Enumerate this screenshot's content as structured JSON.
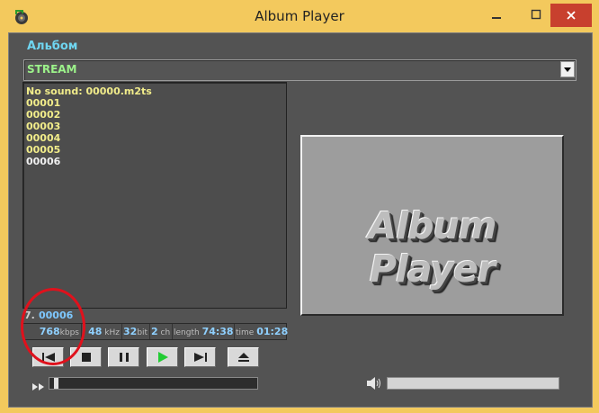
{
  "window": {
    "title": "Album Player",
    "colors": {
      "frame": "#f3c95d",
      "close_button": "#c8402e",
      "client_bg": "#535353"
    }
  },
  "album": {
    "label": "Альбом",
    "selected": "STREAM"
  },
  "playlist": {
    "items": [
      {
        "label": "No sound: 00000.m2ts",
        "color": "#f1ec8a"
      },
      {
        "label": "00001",
        "color": "#f1ec8a"
      },
      {
        "label": "00002",
        "color": "#f1ec8a"
      },
      {
        "label": "00003",
        "color": "#f1ec8a"
      },
      {
        "label": "00004",
        "color": "#f1ec8a"
      },
      {
        "label": "00005",
        "color": "#f1ec8a"
      },
      {
        "label": "00006",
        "color": "#f0f0f0"
      }
    ]
  },
  "now_playing": {
    "number": "7.",
    "name": "00006"
  },
  "info": {
    "bitrate": "768",
    "bitrate_unit": "kbps",
    "samplerate": "48",
    "samplerate_unit": "kHz",
    "bits": "32",
    "bits_unit": "bit",
    "channels": "2",
    "channels_unit": "ch",
    "length_label": "length",
    "length": "74:38",
    "time_label": "time",
    "time": "01:28"
  },
  "controls": {
    "icons": [
      "prev-icon",
      "stop-icon",
      "pause-icon",
      "play-icon",
      "next-icon",
      "eject-icon"
    ],
    "play_color": "#22cc33"
  },
  "seek": {
    "icon": "fast-forward-icon",
    "progress": 0.02
  },
  "volume": {
    "icon": "speaker-icon",
    "level": 1.0
  },
  "cover": {
    "text": "Album Player"
  },
  "annotation": {
    "color": "#e0111c",
    "shape": "red-ellipse-highlight"
  }
}
